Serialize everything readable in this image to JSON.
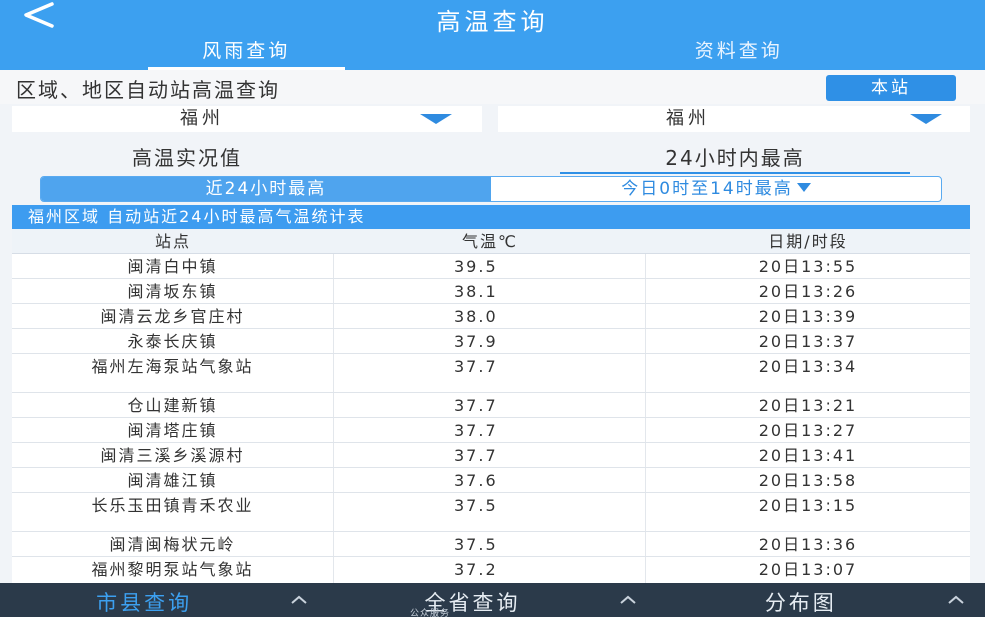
{
  "header": {
    "title": "高温查询",
    "tabs": [
      {
        "label": "风雨查询",
        "active": true
      },
      {
        "label": "资料查询",
        "active": false
      }
    ]
  },
  "section": {
    "title": "区域、地区自动站高温查询",
    "local_button": "本站"
  },
  "selects": {
    "left_value": "福州",
    "right_value": "福州"
  },
  "labels": {
    "left": "高温实况值",
    "right": "24小时内最高"
  },
  "segment": {
    "left": "近24小时最高",
    "right": "今日0时至14时最高"
  },
  "table": {
    "caption": "福州区域 自动站近24小时最高气温统计表",
    "headers": [
      "站点",
      "气温℃",
      "日期/时段"
    ],
    "rows": [
      {
        "station": "闽清白中镇",
        "temp": "39.5",
        "time": "20日13:55"
      },
      {
        "station": "闽清坂东镇",
        "temp": "38.1",
        "time": "20日13:26"
      },
      {
        "station": "闽清云龙乡官庄村",
        "temp": "38.0",
        "time": "20日13:39"
      },
      {
        "station": "永泰长庆镇",
        "temp": "37.9",
        "time": "20日13:37"
      },
      {
        "station": "福州左海泵站气象站",
        "temp": "37.7",
        "time": "20日13:34"
      },
      {
        "station": "仓山建新镇",
        "temp": "37.7",
        "time": "20日13:21"
      },
      {
        "station": "闽清塔庄镇",
        "temp": "37.7",
        "time": "20日13:27"
      },
      {
        "station": "闽清三溪乡溪源村",
        "temp": "37.7",
        "time": "20日13:41"
      },
      {
        "station": "闽清雄江镇",
        "temp": "37.6",
        "time": "20日13:58"
      },
      {
        "station": "长乐玉田镇青禾农业",
        "temp": "37.5",
        "time": "20日13:15"
      },
      {
        "station": "闽清闽梅状元岭",
        "temp": "37.5",
        "time": "20日13:36"
      },
      {
        "station": "福州黎明泵站气象站",
        "temp": "37.2",
        "time": "20日13:07"
      }
    ]
  },
  "bottom_nav": {
    "items": [
      {
        "label": "市县查询",
        "active": true
      },
      {
        "label": "全省查询",
        "active": false
      },
      {
        "label": "分布图",
        "active": false
      }
    ],
    "sub_label": "公众服务"
  },
  "colors": {
    "primary": "#3ca0f0",
    "accent": "#2f90e6",
    "nav_bg": "#2b3a4a"
  }
}
